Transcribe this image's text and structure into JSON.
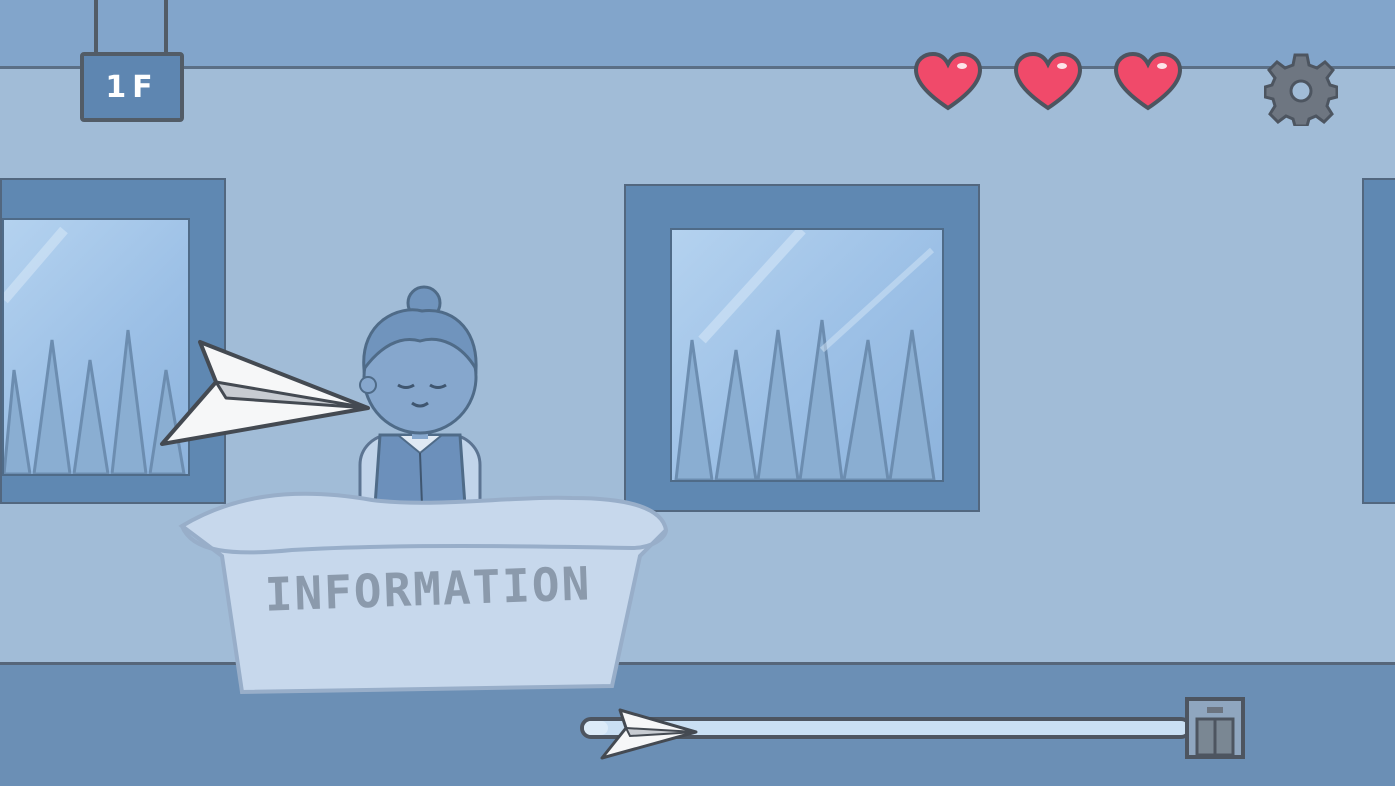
{
  "hud": {
    "floor_label": "1F",
    "lives": {
      "current": 3,
      "max": 3
    },
    "settings_icon": "gear-icon"
  },
  "scene": {
    "desk_label": "INFORMATION"
  },
  "progress": {
    "value": 0.04,
    "start_icon": "paper-plane-icon",
    "end_icon": "elevator-icon"
  },
  "colors": {
    "heart": "#f04a6a",
    "ui_outline": "#4d5560",
    "floor_sign": "#5e86b1"
  }
}
